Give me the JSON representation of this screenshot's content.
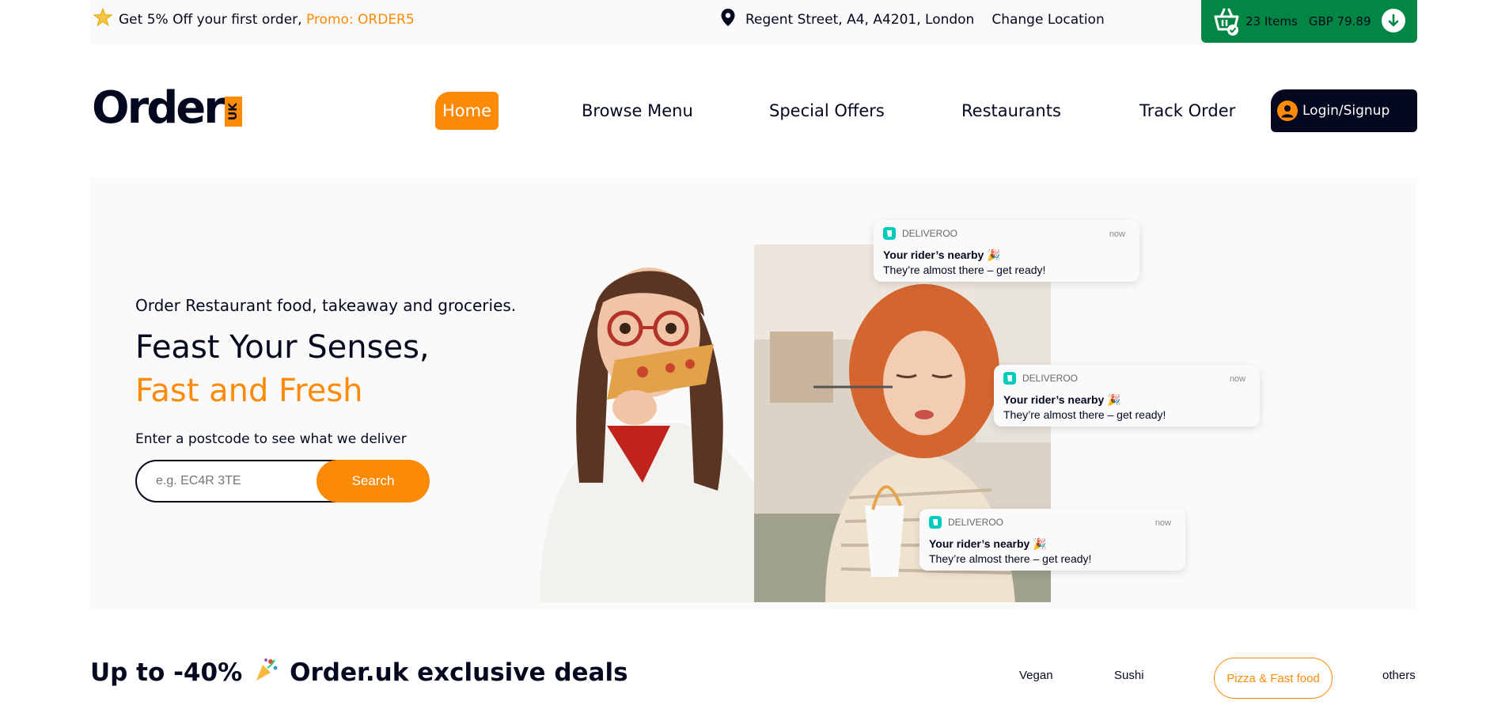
{
  "topbar": {
    "promo_text": "Get 5% Off your first order,",
    "promo_code": "Promo: ORDER5",
    "address": "Regent Street, A4, A4201, London",
    "change_location": "Change Location"
  },
  "cart": {
    "items": "23 Items",
    "total": "GBP 79.89"
  },
  "logo": {
    "word": "Order",
    "badge": "UK"
  },
  "nav": {
    "home": "Home",
    "browse_menu": "Browse Menu",
    "special_offers": "Special Offers",
    "restaurants": "Restaurants",
    "track_order": "Track Order",
    "login": "Login/Signup"
  },
  "hero": {
    "tagline": "Order Restaurant food, takeaway and groceries.",
    "headline_1": "Feast Your Senses,",
    "headline_2": "Fast and Fresh",
    "postcode_label": "Enter a postcode to see what we deliver",
    "search_placeholder": "e.g. EC4R 3TE",
    "search_button": "Search"
  },
  "notifications": [
    {
      "app": "DELIVEROO",
      "time": "now",
      "title": "Your rider’s nearby 🎉",
      "body": "They’re almost there – get ready!"
    },
    {
      "app": "DELIVEROO",
      "time": "now",
      "title": "Your rider’s nearby 🎉",
      "body": "They’re almost there – get ready!"
    },
    {
      "app": "DELIVEROO",
      "time": "now",
      "title": "Your rider’s nearby 🎉",
      "body": "They’re almost there – get ready!"
    }
  ],
  "deals": {
    "prefix": "Up to -40%",
    "title": "Order.uk exclusive deals",
    "categories": [
      "Vegan",
      "Sushi",
      "Pizza & Fast food",
      "others"
    ]
  },
  "colors": {
    "accent": "#FC8A06",
    "dark": "#03081F",
    "cart_green": "#028643",
    "deliveroo": "#00CCBC"
  }
}
